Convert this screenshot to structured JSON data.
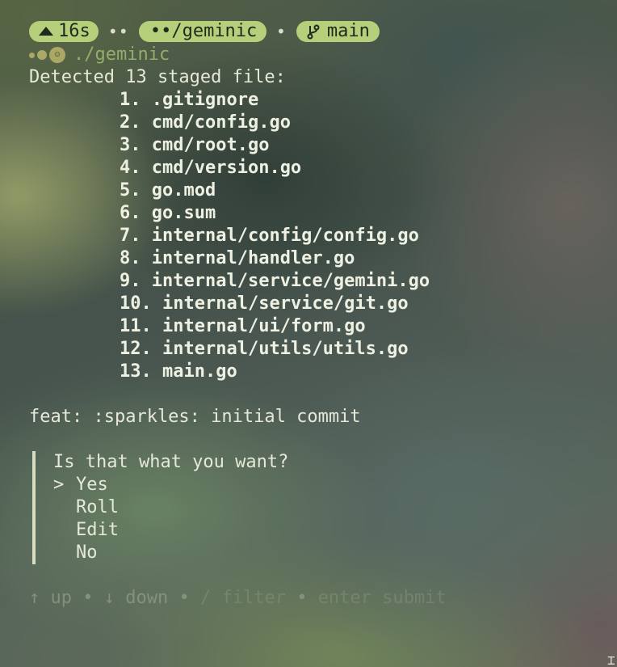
{
  "prompt": {
    "duration": "16s",
    "separator1": "••",
    "directory": "••/geminic",
    "separator2": "•",
    "branch": "main"
  },
  "subprompt": {
    "path": "./geminic"
  },
  "detected_line": "Detected 13 staged file:",
  "files": [
    {
      "num": "1.",
      "name": ".gitignore"
    },
    {
      "num": "2.",
      "name": "cmd/config.go"
    },
    {
      "num": "3.",
      "name": "cmd/root.go"
    },
    {
      "num": "4.",
      "name": "cmd/version.go"
    },
    {
      "num": "5.",
      "name": "go.mod"
    },
    {
      "num": "6.",
      "name": "go.sum"
    },
    {
      "num": "7.",
      "name": "internal/config/config.go"
    },
    {
      "num": "8.",
      "name": "internal/handler.go"
    },
    {
      "num": "9.",
      "name": "internal/service/gemini.go"
    },
    {
      "num": "10.",
      "name": "internal/service/git.go"
    },
    {
      "num": "11.",
      "name": "internal/ui/form.go"
    },
    {
      "num": "12.",
      "name": "internal/utils/utils.go"
    },
    {
      "num": "13.",
      "name": "main.go"
    }
  ],
  "commit_message": "feat: :sparkles: initial commit",
  "form": {
    "question": "Is that what you want?",
    "cursor": ">",
    "options": [
      "Yes",
      "Roll",
      "Edit",
      "No"
    ],
    "selected": "Yes"
  },
  "help": {
    "up": "↑ up",
    "dot1": "•",
    "down": "↓ down",
    "dot2": "•",
    "filter": "/ filter",
    "dot3": "•",
    "submit": "enter submit"
  },
  "colors": {
    "pill": "#b5cf7a",
    "pill_text": "#1f2a1c",
    "text": "#e6e8d8",
    "subprompt": "#a8c978"
  }
}
